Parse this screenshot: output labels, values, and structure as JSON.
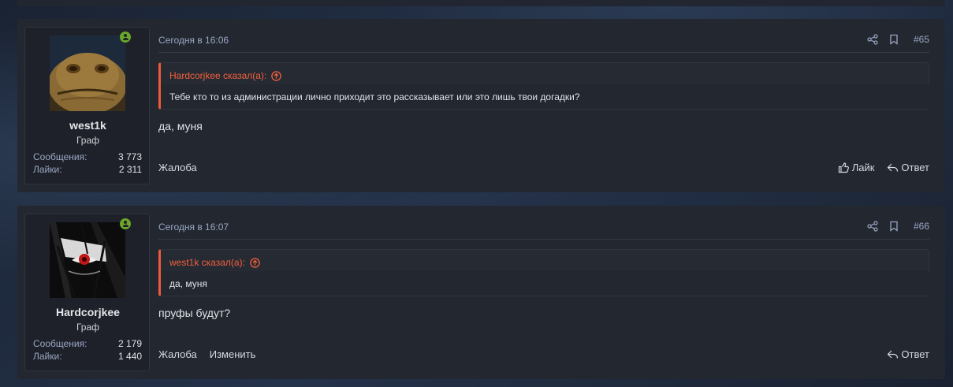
{
  "posts": [
    {
      "user": {
        "name": "west1k",
        "title": "Граф",
        "messages_label": "Сообщения:",
        "messages": "3 773",
        "likes_label": "Лайки:",
        "likes": "2 311"
      },
      "date": "Сегодня в 16:06",
      "number": "#65",
      "quote": {
        "author": "Hardcorjkee сказал(а):",
        "text": "Тебе кто то из администрации лично приходит это рассказывает или это лишь твои догадки?"
      },
      "body": "да, муня",
      "footer_left": [
        "Жалоба"
      ],
      "like_label": "Лайк",
      "reply_label": "Ответ"
    },
    {
      "user": {
        "name": "Hardcorjkee",
        "title": "Граф",
        "messages_label": "Сообщения:",
        "messages": "2 179",
        "likes_label": "Лайки:",
        "likes": "1 440"
      },
      "date": "Сегодня в 16:07",
      "number": "#66",
      "quote": {
        "author": "west1k сказал(а):",
        "text": "да, муня"
      },
      "body": "пруфы будут?",
      "footer_left": [
        "Жалоба",
        "Изменить"
      ],
      "reply_label": "Ответ"
    }
  ],
  "colors": {
    "accent": "#f05a3a",
    "online": "#6aa629",
    "muted": "#9aa8c4"
  },
  "icons": [
    "share-icon",
    "bookmark-icon",
    "arrow-up-circle-icon",
    "thumbs-up-icon",
    "reply-icon",
    "online-icon"
  ]
}
